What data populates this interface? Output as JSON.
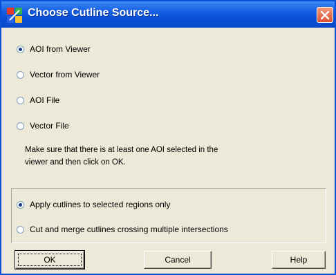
{
  "dialog": {
    "title": "Choose Cutline Source...",
    "icons": {
      "app": "app-icon",
      "close": "close-icon"
    },
    "colors": {
      "titlebar": "#0a52d8",
      "close": "#d9502e",
      "face": "#ece9d8"
    }
  },
  "source_options": [
    {
      "label": "AOI from Viewer",
      "checked": true
    },
    {
      "label": "Vector from Viewer",
      "checked": false
    },
    {
      "label": "AOI File",
      "checked": false
    },
    {
      "label": "Vector File",
      "checked": false
    }
  ],
  "note": {
    "line1": "Make sure that there is at least one AOI selected in the",
    "line2": "viewer and then click on OK."
  },
  "apply_options": [
    {
      "label": "Apply cutlines to selected regions only",
      "checked": true
    },
    {
      "label": "Cut and merge cutlines crossing multiple intersections",
      "checked": false
    }
  ],
  "buttons": {
    "ok": "OK",
    "cancel": "Cancel",
    "help": "Help"
  }
}
